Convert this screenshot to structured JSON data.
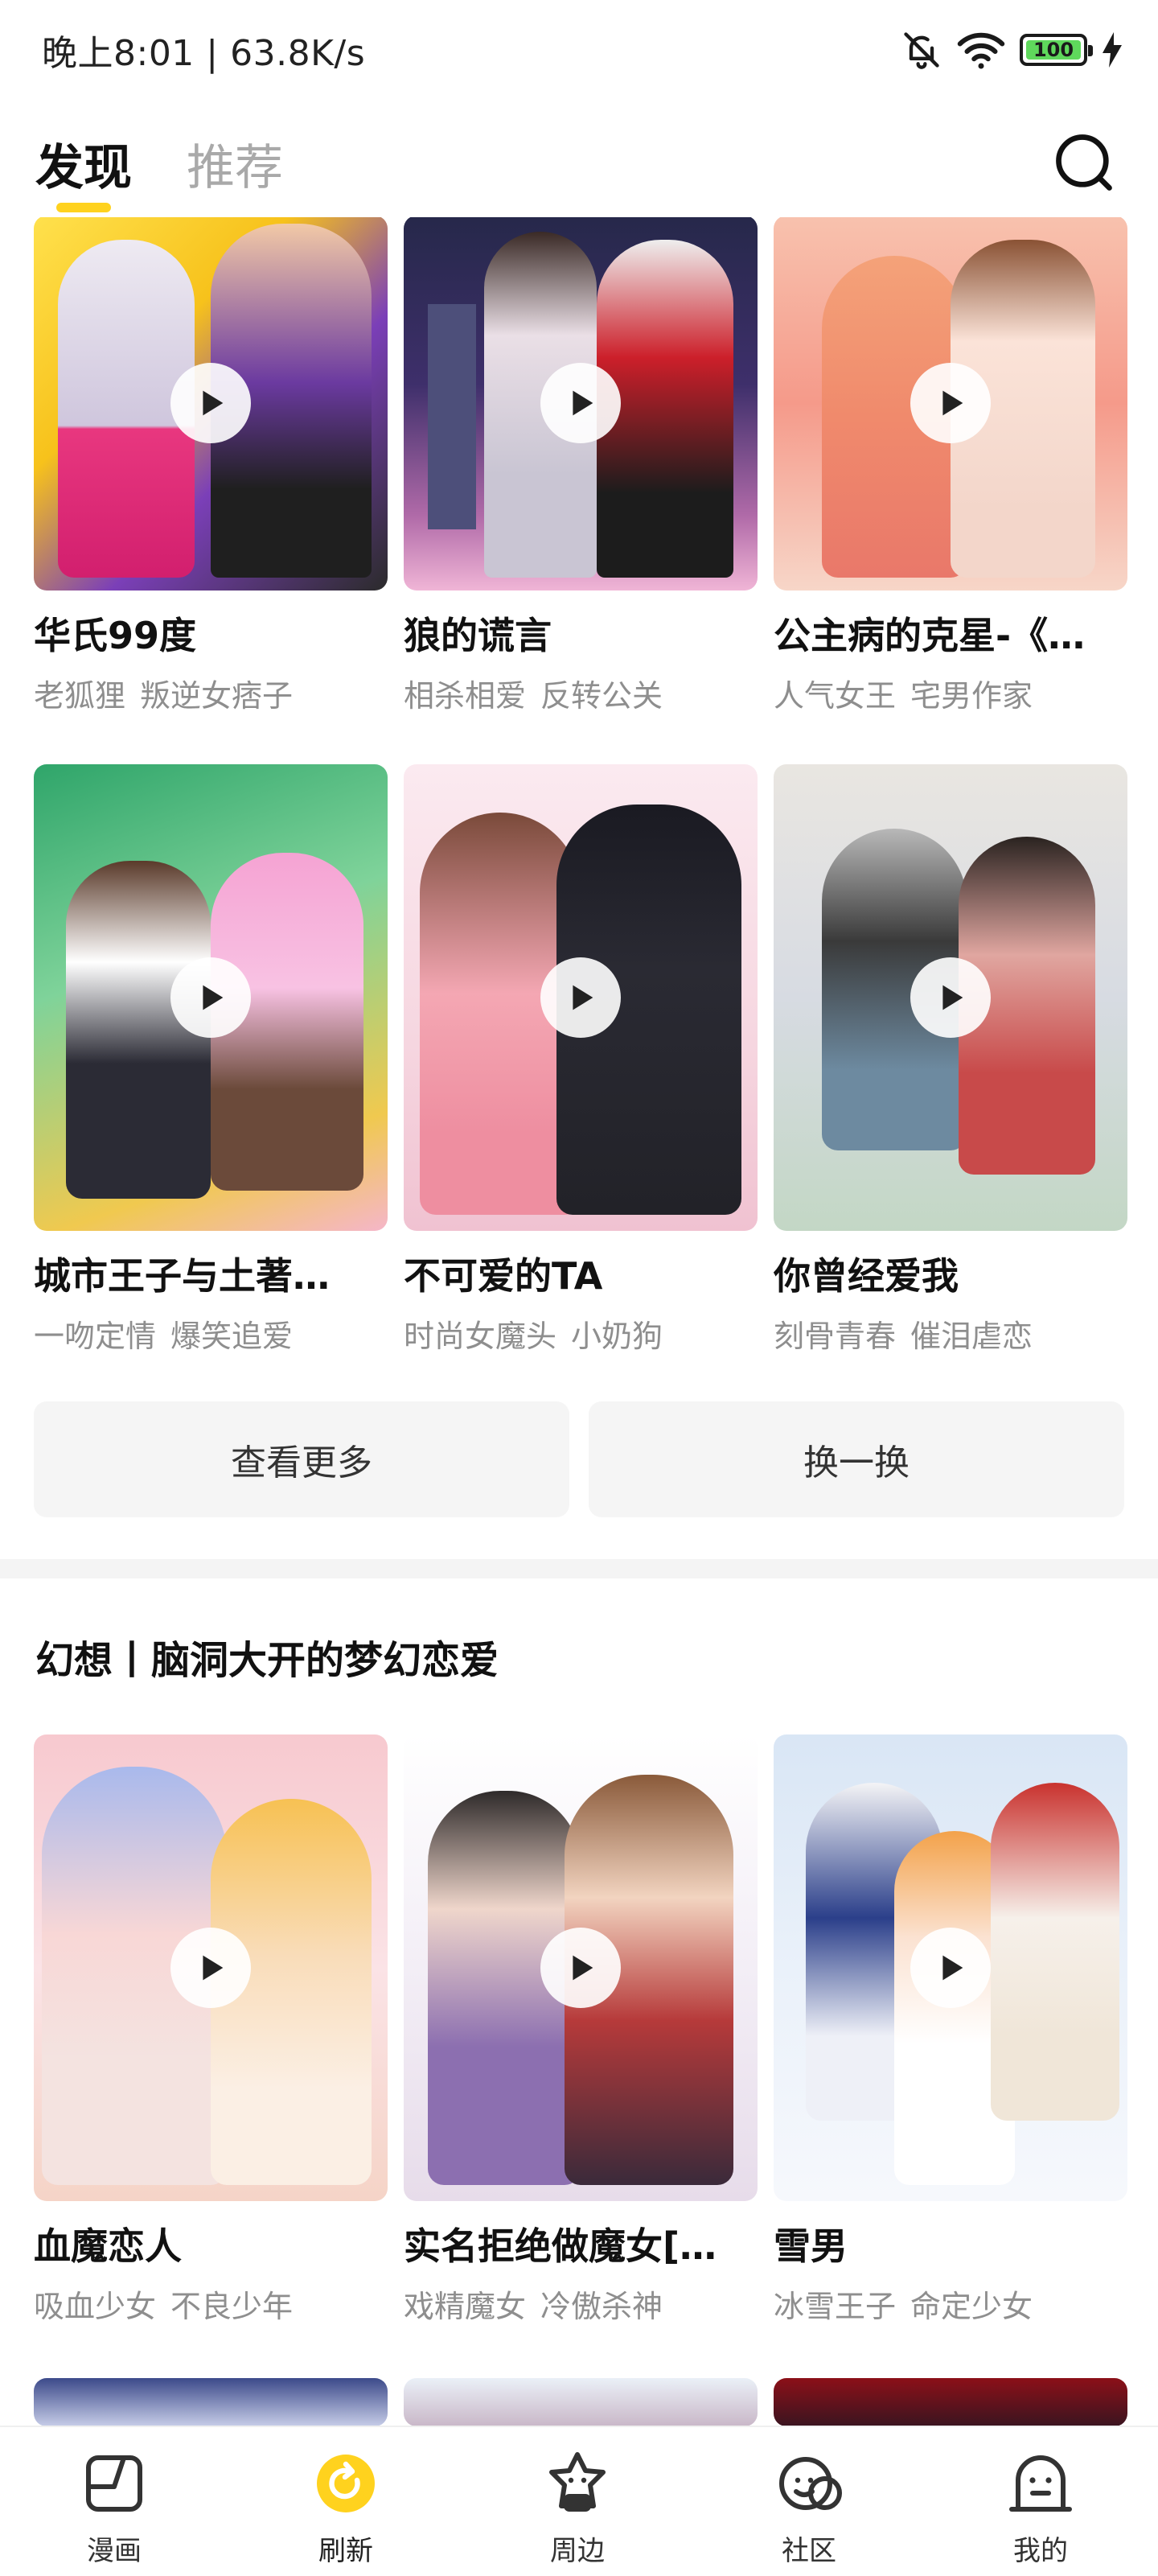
{
  "status_bar": {
    "text": "晚上8:01 | 63.8K/s",
    "battery_level": "100",
    "icons": [
      "bell-off-icon",
      "wifi-icon",
      "battery-icon",
      "charging-icon"
    ]
  },
  "header": {
    "tabs": [
      {
        "label": "发现",
        "active": true
      },
      {
        "label": "推荐",
        "active": false
      }
    ],
    "search_icon": "search-icon",
    "accent_color": "#ffd21e"
  },
  "grid_1": [
    {
      "title": "华氏99度",
      "tags": [
        "老狐狸",
        "叛逆女痞子"
      ]
    },
    {
      "title": "狼的谎言",
      "tags": [
        "相杀相爱",
        "反转公关"
      ]
    },
    {
      "title": "公主病的克星-《…",
      "tags": [
        "人气女王",
        "宅男作家"
      ]
    }
  ],
  "grid_2": [
    {
      "title": "城市王子与土著…",
      "tags": [
        "一吻定情",
        "爆笑追爱"
      ]
    },
    {
      "title": "不可爱的TA",
      "tags": [
        "时尚女魔头",
        "小奶狗"
      ]
    },
    {
      "title": "你曾经爱我",
      "tags": [
        "刻骨青春",
        "催泪虐恋"
      ]
    }
  ],
  "actions": {
    "more": "查看更多",
    "refresh": "换一换"
  },
  "section": {
    "title": "幻想丨脑洞大开的梦幻恋爱"
  },
  "grid_3": [
    {
      "title": "血魔恋人",
      "tags": [
        "吸血少女",
        "不良少年"
      ]
    },
    {
      "title": "实名拒绝做魔女[…",
      "tags": [
        "戏精魔女",
        "冷傲杀神"
      ]
    },
    {
      "title": "雪男",
      "tags": [
        "冰雪王子",
        "命定少女"
      ]
    }
  ],
  "bottom_nav": [
    {
      "label": "漫画",
      "icon": "comic-icon",
      "active": false
    },
    {
      "label": "刷新",
      "icon": "refresh-icon",
      "active": true
    },
    {
      "label": "周边",
      "icon": "ip-merch-icon",
      "active": false
    },
    {
      "label": "社区",
      "icon": "community-icon",
      "active": false
    },
    {
      "label": "我的",
      "icon": "profile-icon",
      "active": false
    }
  ]
}
